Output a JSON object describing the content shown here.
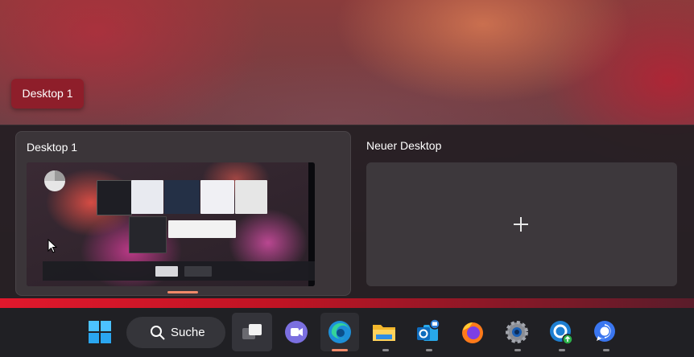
{
  "tooltip": {
    "label": "Desktop 1"
  },
  "desktops": [
    {
      "label": "Desktop 1",
      "active": true
    },
    {
      "label": "Neuer Desktop",
      "active": false
    }
  ],
  "taskbar": {
    "search_label": "Suche",
    "icons": [
      "windows-start-icon",
      "search-icon",
      "task-view-icon",
      "teams-chat-icon",
      "edge-browser-icon",
      "file-explorer-icon",
      "outlook-icon",
      "firefox-icon",
      "settings-icon",
      "ccleaner-icon",
      "signal-icon"
    ]
  },
  "colors": {
    "accent": "#f08a6a",
    "tooltip_bg": "#8e1e2a",
    "taskbar_bg": "#202024"
  }
}
